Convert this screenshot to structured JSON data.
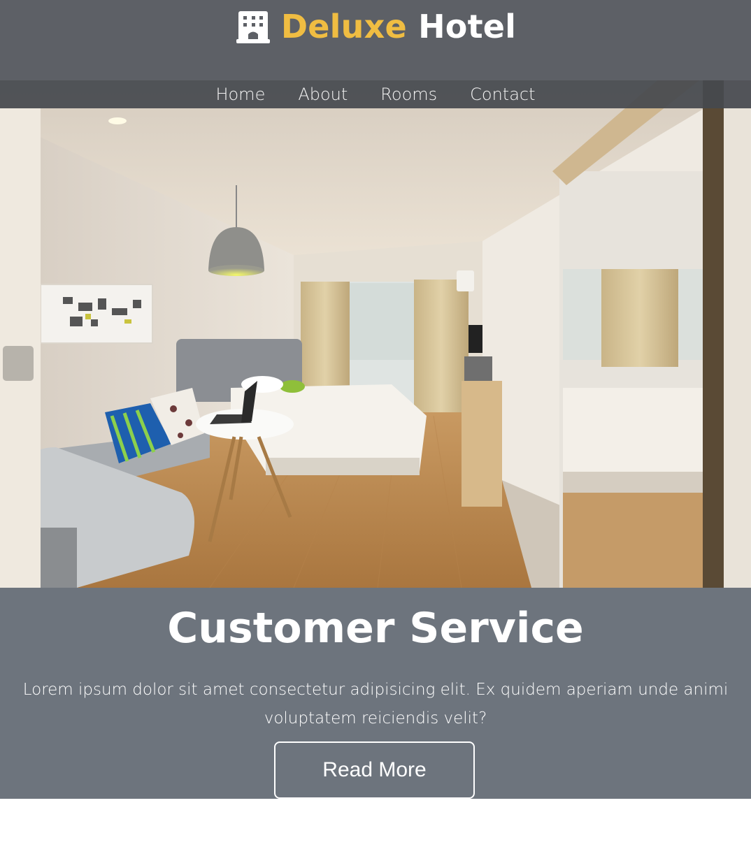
{
  "brand": {
    "icon": "hotel-building-icon",
    "word1": "Deluxe",
    "word2": "Hotel",
    "accent_color": "#f0bd42"
  },
  "nav": {
    "items": [
      {
        "label": "Home"
      },
      {
        "label": "About"
      },
      {
        "label": "Rooms"
      },
      {
        "label": "Contact"
      }
    ]
  },
  "hero": {
    "image": "hotel-room-photo"
  },
  "service": {
    "title": "Customer Service",
    "text": "Lorem ipsum dolor sit amet consectetur adipisicing elit. Ex quidem aperiam unde animi voluptatem reiciendis velit?",
    "button_label": "Read More"
  },
  "colors": {
    "header_bg": "#5d6066",
    "service_bg": "#6d747d"
  }
}
